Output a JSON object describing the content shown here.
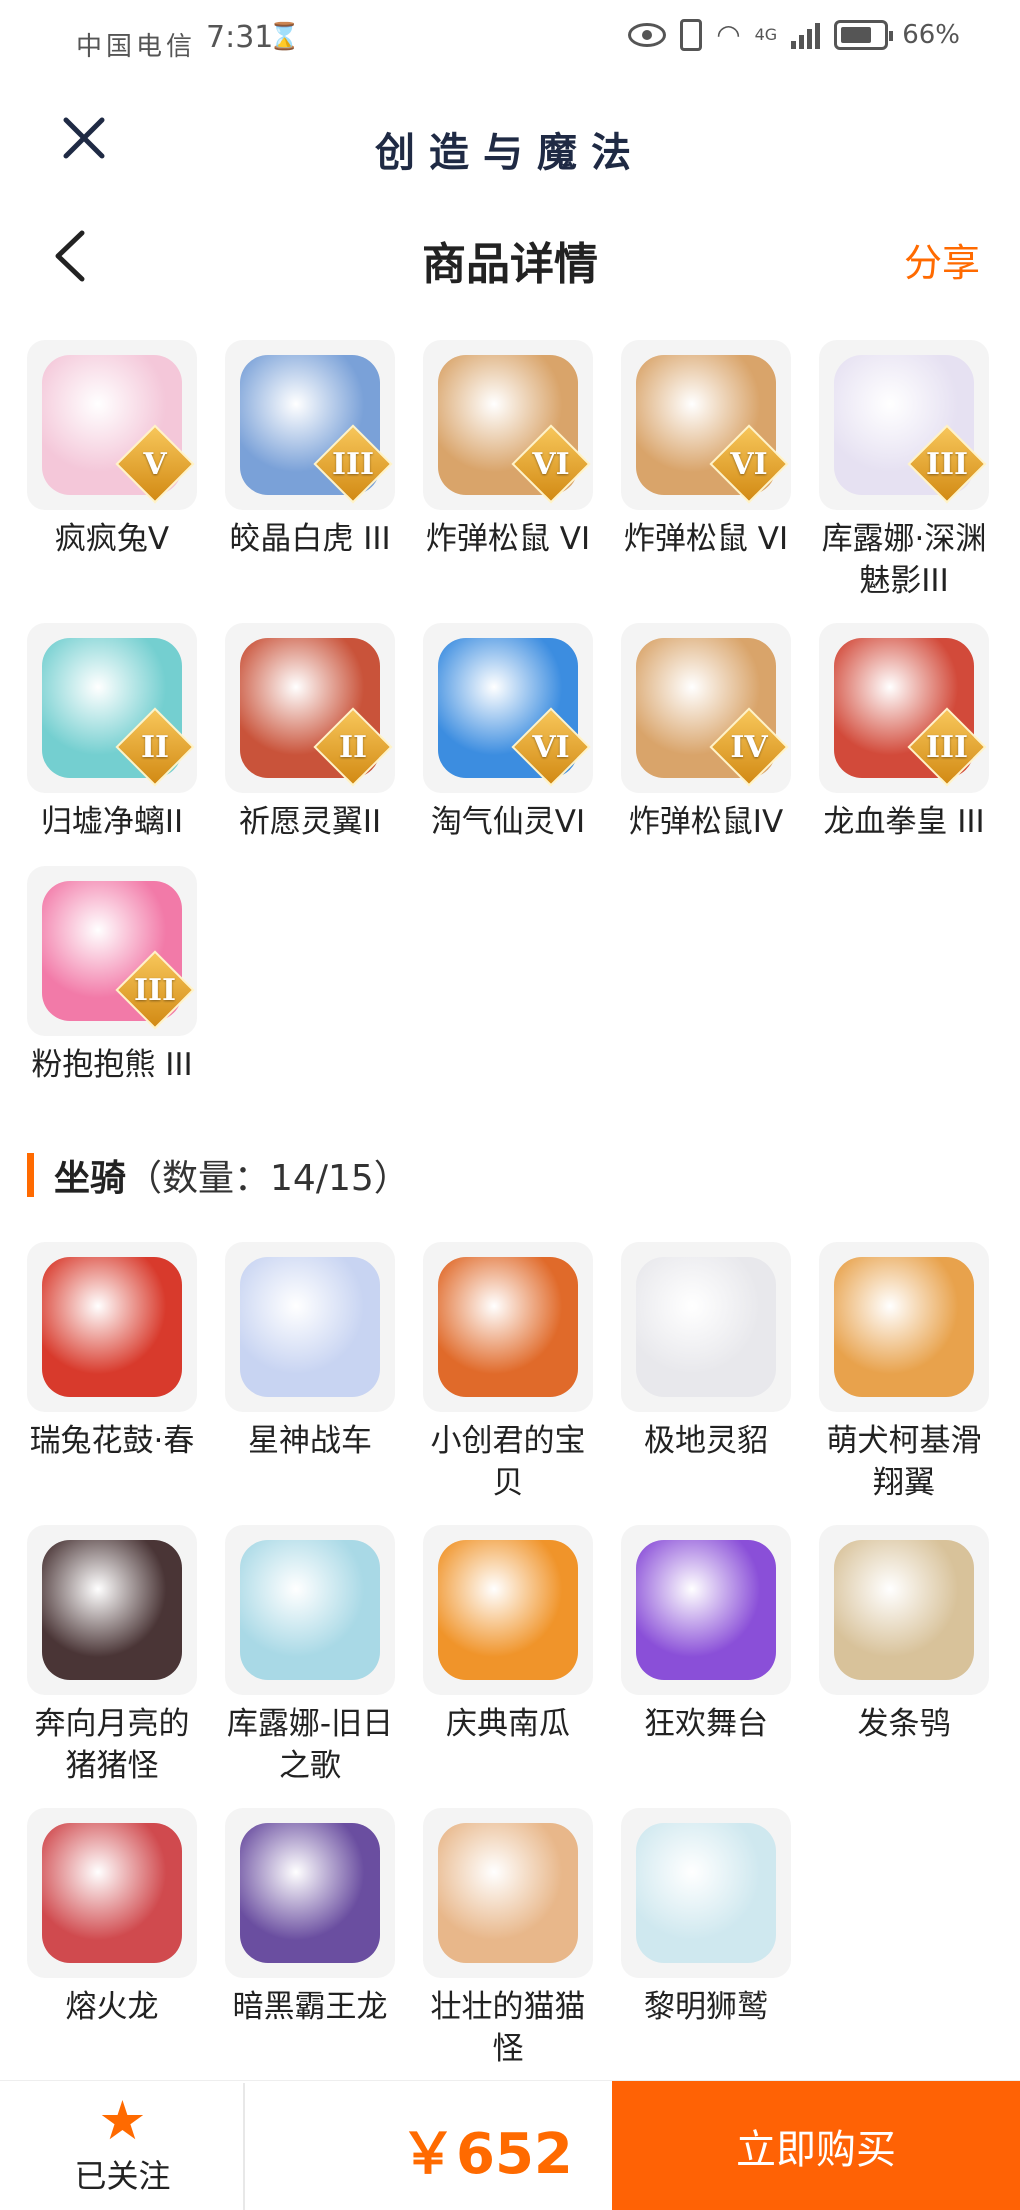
{
  "status_bar": {
    "carrier": "中国电信",
    "time": "7:31",
    "network": "4G",
    "battery": "66%"
  },
  "app": {
    "title": "创造与魔法"
  },
  "header": {
    "title": "商品详情",
    "share_label": "分享"
  },
  "pets": [
    {
      "name": "疯疯兔V",
      "rank": "V",
      "color": "#f4c7d9"
    },
    {
      "name": "皎晶白虎 III",
      "rank": "III",
      "color": "#7aa1d8"
    },
    {
      "name": "炸弹松鼠 VI",
      "rank": "VI",
      "color": "#d9a46a"
    },
    {
      "name": "炸弹松鼠 VI",
      "rank": "VI",
      "color": "#d9a46a"
    },
    {
      "name": "库露娜·深渊魅影III",
      "rank": "III",
      "color": "#e6e1f2"
    },
    {
      "name": "归墟净螭II",
      "rank": "II",
      "color": "#74cfd0"
    },
    {
      "name": "祈愿灵翼II",
      "rank": "II",
      "color": "#c9533a"
    },
    {
      "name": "淘气仙灵VI",
      "rank": "VI",
      "color": "#3c8de0"
    },
    {
      "name": "炸弹松鼠IV",
      "rank": "IV",
      "color": "#d9a46a"
    },
    {
      "name": "龙血拳皇 III",
      "rank": "III",
      "color": "#d24a3a"
    },
    {
      "name": "粉抱抱熊 III",
      "rank": "III",
      "color": "#f27aa8"
    }
  ],
  "mounts_section": {
    "name": "坐骑",
    "count": "（数量：14/15）"
  },
  "mounts": [
    {
      "name": "瑞兔花鼓·春",
      "color": "#d83a2c"
    },
    {
      "name": "星神战车",
      "color": "#c8d4f2"
    },
    {
      "name": "小创君的宝贝",
      "color": "#e06a2a"
    },
    {
      "name": "极地灵貂",
      "color": "#e8e8ec"
    },
    {
      "name": "萌犬柯基滑翔翼",
      "color": "#e8a24c"
    },
    {
      "name": "奔向月亮的猪猪怪",
      "color": "#4a3536"
    },
    {
      "name": "库露娜-旧日之歌",
      "color": "#a9d9e6"
    },
    {
      "name": "庆典南瓜",
      "color": "#f0942a"
    },
    {
      "name": "狂欢舞台",
      "color": "#8a4fd8"
    },
    {
      "name": "发条鸮",
      "color": "#d8c29a"
    },
    {
      "name": "熔火龙",
      "color": "#d04a4e"
    },
    {
      "name": "暗黑霸王龙",
      "color": "#6a4ea0"
    },
    {
      "name": "壮壮的猫猫怪",
      "color": "#e8b78a"
    },
    {
      "name": "黎明狮鹫",
      "color": "#cfe8ef"
    }
  ],
  "bottom_bar": {
    "follow_label": "已关注",
    "price": "￥652",
    "buy_label": "立即购买"
  }
}
